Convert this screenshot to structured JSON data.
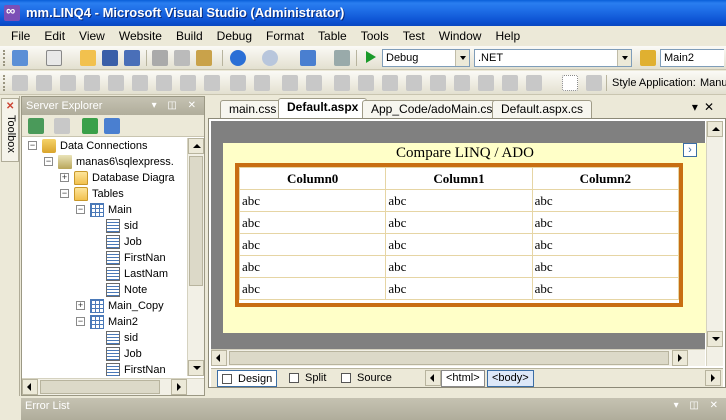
{
  "window": {
    "title": "mm.LINQ4 - Microsoft Visual Studio (Administrator)"
  },
  "menu": [
    "File",
    "Edit",
    "View",
    "Website",
    "Build",
    "Debug",
    "Format",
    "Table",
    "Tools",
    "Test",
    "Window",
    "Help"
  ],
  "toolbar": {
    "configuration": "Debug",
    "platform": ".NET",
    "find_target": "Main2",
    "style_application_label": "Style Application:",
    "style_application_value": "Manu"
  },
  "toolbox": {
    "label": "Toolbox"
  },
  "server_explorer": {
    "title": "Server Explorer",
    "tree": [
      {
        "label": "Data Connections",
        "icon": "database-icon",
        "expander": "−"
      },
      {
        "label": "manas6\\sqlexpress.",
        "icon": "server-icon",
        "expander": "−"
      },
      {
        "label": "Database Diagra",
        "icon": "folder-icon",
        "expander": "+"
      },
      {
        "label": "Tables",
        "icon": "folder-icon",
        "expander": "−"
      },
      {
        "label": "Main",
        "icon": "table-icon",
        "expander": "−"
      },
      {
        "label": "sid",
        "icon": "column-icon",
        "expander": ""
      },
      {
        "label": "Job",
        "icon": "column-icon",
        "expander": ""
      },
      {
        "label": "FirstNan",
        "icon": "column-icon",
        "expander": ""
      },
      {
        "label": "LastNam",
        "icon": "column-icon",
        "expander": ""
      },
      {
        "label": "Note",
        "icon": "column-icon",
        "expander": ""
      },
      {
        "label": "Main_Copy",
        "icon": "table-icon",
        "expander": "+"
      },
      {
        "label": "Main2",
        "icon": "table-icon",
        "expander": "−"
      },
      {
        "label": "sid",
        "icon": "column-icon",
        "expander": ""
      },
      {
        "label": "Job",
        "icon": "column-icon",
        "expander": ""
      },
      {
        "label": "FirstNan",
        "icon": "column-icon",
        "expander": ""
      }
    ]
  },
  "tabs": [
    {
      "label": "main.css"
    },
    {
      "label": "Default.aspx"
    },
    {
      "label": "App_Code/adoMain.cs"
    },
    {
      "label": "Default.aspx.cs"
    }
  ],
  "designer": {
    "caption": "Compare LINQ / ADO",
    "smart_tag": "›",
    "columns": [
      "Column0",
      "Column1",
      "Column2"
    ],
    "rows": [
      [
        "abc",
        "abc",
        "abc"
      ],
      [
        "abc",
        "abc",
        "abc"
      ],
      [
        "abc",
        "abc",
        "abc"
      ],
      [
        "abc",
        "abc",
        "abc"
      ],
      [
        "abc",
        "abc",
        "abc"
      ]
    ]
  },
  "view_bar": {
    "design": "Design",
    "split": "Split",
    "source": "Source",
    "tag_html": "<html>",
    "tag_body": "<body>"
  },
  "error_list": {
    "title": "Error List"
  },
  "colors": {
    "grid_border": "#c86e12",
    "form_background": "#ffffc8",
    "titlebar": "#0b4fd0"
  }
}
